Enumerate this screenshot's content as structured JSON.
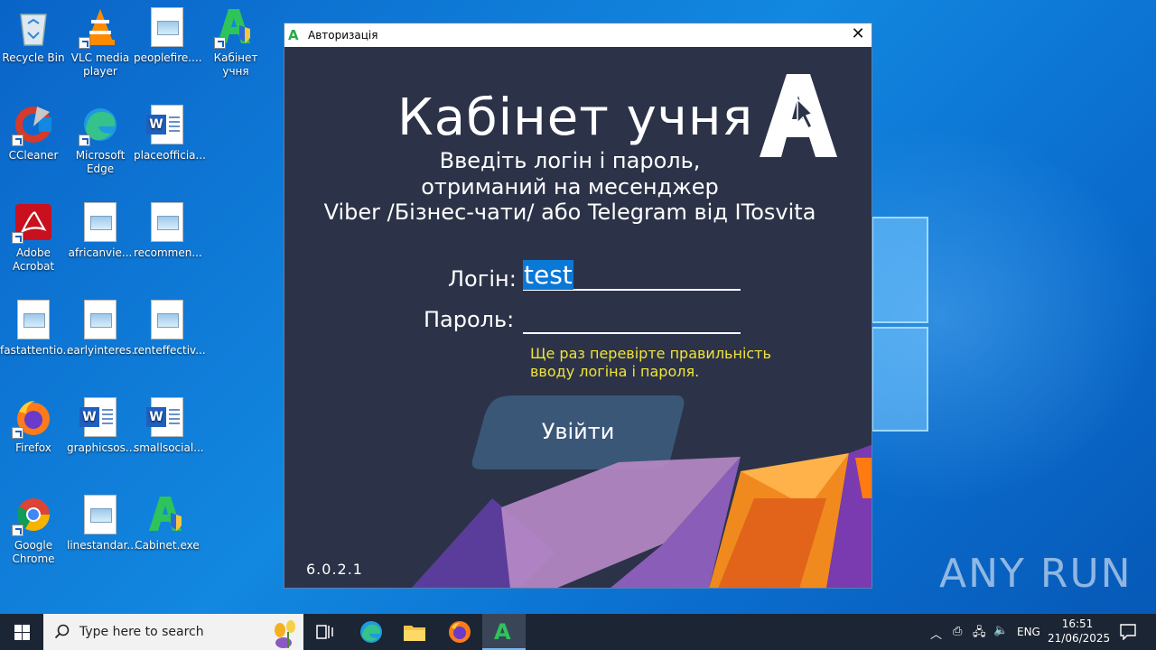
{
  "desktop": {
    "icons": [
      {
        "label": "Recycle Bin",
        "type": "recycle"
      },
      {
        "label": "VLC media player",
        "type": "vlc"
      },
      {
        "label": "peoplefire....",
        "type": "image-file"
      },
      {
        "label": "Кабінет учня",
        "type": "cabinet"
      },
      {
        "label": "CCleaner",
        "type": "ccleaner"
      },
      {
        "label": "Microsoft Edge",
        "type": "edge"
      },
      {
        "label": "placeofficia...",
        "type": "word-file"
      },
      {
        "label": "Adobe Acrobat",
        "type": "acrobat"
      },
      {
        "label": "africanvie...",
        "type": "image-file"
      },
      {
        "label": "recommen...",
        "type": "image-file"
      },
      {
        "label": "fastattentio...",
        "type": "image-file"
      },
      {
        "label": "earlyinteres...",
        "type": "image-file"
      },
      {
        "label": "renteffectiv...",
        "type": "image-file"
      },
      {
        "label": "Firefox",
        "type": "firefox"
      },
      {
        "label": "graphicsos...",
        "type": "word-file"
      },
      {
        "label": "smallsocial...",
        "type": "word-file"
      },
      {
        "label": "Google Chrome",
        "type": "chrome"
      },
      {
        "label": "linestandar...",
        "type": "image-file"
      },
      {
        "label": "Cabinet.exe",
        "type": "cabinet"
      }
    ],
    "watermark": "ANY RUN"
  },
  "dialog": {
    "title": "Авторизація",
    "heading": "Кабінет учня",
    "subtitle_lines": [
      "Введіть логін і пароль,",
      "отриманий на месенджер",
      "Viber /Бізнес-чати/ або Telegram від ITosvita"
    ],
    "login_label": "Логін:",
    "login_value": "test",
    "password_label": "Пароль:",
    "password_value": "",
    "warning_lines": [
      "Ще раз перевірте правильність",
      "вводу логіна і пароля."
    ],
    "login_button": "Увійти",
    "version": "6.0.2.1",
    "colors": {
      "background": "#2c3348",
      "warning": "#f0e33a",
      "button": "#3a5778",
      "selection": "#0a78d7"
    }
  },
  "taskbar": {
    "search_placeholder": "Type here to search",
    "language": "ENG",
    "time": "16:51",
    "date": "21/06/2025"
  }
}
